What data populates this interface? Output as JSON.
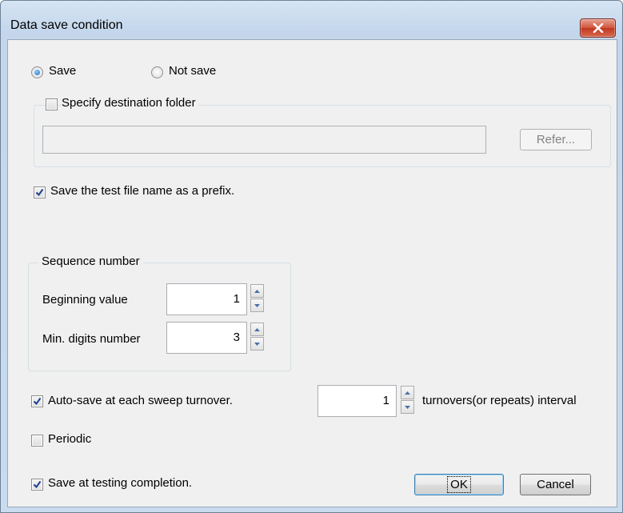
{
  "dialog": {
    "title": "Data save condition",
    "close_icon": "close-x-icon"
  },
  "save_mode": {
    "save_label": "Save",
    "not_save_label": "Not save",
    "selected": "Save"
  },
  "destination": {
    "specify_label": "Specify destination folder",
    "specify_checked": false,
    "folder_value": "",
    "refer_label": "Refer..."
  },
  "prefix": {
    "label": "Save the test file name as a prefix.",
    "checked": true
  },
  "sequence": {
    "group_label": "Sequence number",
    "beginning_label": "Beginning value",
    "beginning_value": "1",
    "min_digits_label": "Min. digits number",
    "min_digits_value": "3"
  },
  "autosave": {
    "label": "Auto-save at each sweep turnover.",
    "checked": true,
    "interval_value": "1",
    "interval_suffix": "turnovers(or repeats) interval"
  },
  "periodic": {
    "label": "Periodic",
    "checked": false
  },
  "completion": {
    "label": "Save at testing completion.",
    "checked": true
  },
  "buttons": {
    "ok_label": "OK",
    "cancel_label": "Cancel"
  },
  "colors": {
    "client_bg": "#f0f0f0",
    "title_bar": "#c3d6ec",
    "close_button": "#c2371f",
    "check_mark": "#1f3f8f"
  }
}
